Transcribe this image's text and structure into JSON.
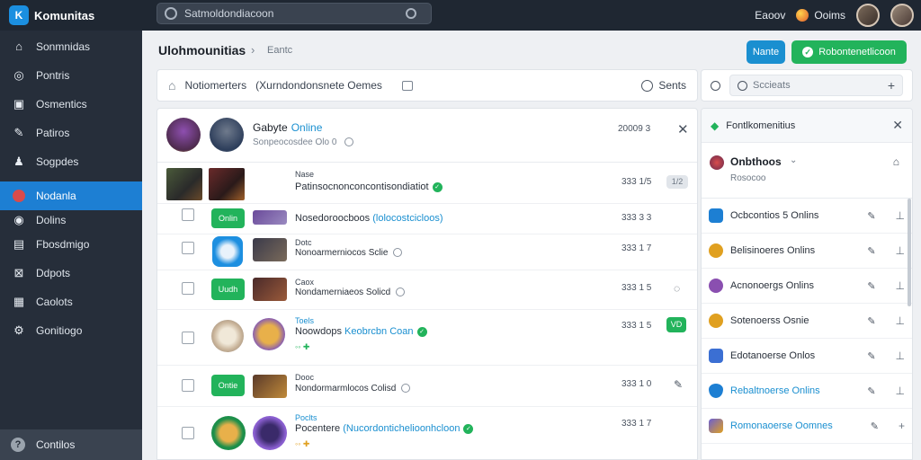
{
  "app": {
    "name": "Komunitas",
    "logo_letter": "K"
  },
  "topbar": {
    "search_placeholder": "Satmoldondiacoon",
    "link1": "Eaoov",
    "link2": "Ooims"
  },
  "sidebar": {
    "items": [
      {
        "label": "Sonmnidas",
        "icon": "home-icon"
      },
      {
        "label": "Pontris",
        "icon": "circle-icon"
      },
      {
        "label": "Osmentics",
        "icon": "document-icon"
      },
      {
        "label": "Patiros",
        "icon": "edit-icon"
      },
      {
        "label": "Sogpdes",
        "icon": "user-icon"
      },
      {
        "label": "Nodanla",
        "icon": "badge-icon",
        "active": true
      },
      {
        "label": "Dolins",
        "icon": "globe-icon"
      },
      {
        "label": "Fbosdmigo",
        "icon": "bag-icon"
      },
      {
        "label": "Ddpots",
        "icon": "share-icon"
      },
      {
        "label": "Caolots",
        "icon": "calendar-icon"
      },
      {
        "label": "Gonitiogo",
        "icon": "gear-icon"
      }
    ],
    "footer_label": "Contilos"
  },
  "header": {
    "title": "Ulohmounitias",
    "breadcrumb": "Eantc",
    "btn_primary": "Nante",
    "btn_success": "Robontenetlicoon"
  },
  "filter": {
    "label": "Notiomerters",
    "query": "(Xurndondonsnete Oemes",
    "sort_label": "Sents",
    "right_placeholder": "Sccieats"
  },
  "list": {
    "head": {
      "name": "Gabyte",
      "status": "Online",
      "subtitle": "Sonpeocosdee Olo",
      "count": "0",
      "id": "20009 3"
    },
    "rows": [
      {
        "title": "Nase",
        "text": "Patinsocnonconcontisondiatiot",
        "id": "333 1/5",
        "action": "1/2"
      },
      {
        "pill": "Onlin",
        "text": "Nosedoroocboos",
        "text_hl": "(lolocostcicloos)",
        "id": "333 3 3"
      },
      {
        "title": "Dotc",
        "text": "Nonoarmerniocos Sclie",
        "id": "333 1 7"
      },
      {
        "pill": "Uudh",
        "title": "Caox",
        "text": "Nondamerniaeos Solicd",
        "id": "333 1 5"
      },
      {
        "title": "Toels",
        "text": "Noowdops",
        "text_hl": "Keobrcbn Coan",
        "id": "333 1 5",
        "action": "VD"
      },
      {
        "pill": "Ontie",
        "title": "Dooc",
        "text": "Nondormarmlocos Colisd",
        "id": "333 1 0"
      },
      {
        "title": "Poclts",
        "text": "Pocentere",
        "text_hl": "(Nucordontichelioonhcloon",
        "id": "333 1 7"
      }
    ]
  },
  "panel": {
    "title": "Fontlkomenitius",
    "user_name": "Onbthoos",
    "user_sub": "Rosocoo",
    "items": [
      {
        "label": "Ocbcontios 5 Onlins",
        "color": "#1d7fd3",
        "blue": false
      },
      {
        "label": "Belisinoeres Onlins",
        "color": "#e0a020",
        "blue": false
      },
      {
        "label": "Acnonoergs Onlins",
        "color": "#8a4fb0",
        "blue": false
      },
      {
        "label": "Sotenoerss Osnie",
        "color": "#e0a020",
        "blue": false
      },
      {
        "label": "Edotanoerse Onlos",
        "color": "#3b6fd3",
        "blue": false
      },
      {
        "label": "Rebaltnoerse Onlins",
        "color": "#1d7fd3",
        "blue": true
      },
      {
        "label": "Romonaoerse Oomnes",
        "color": "#6a5fd3",
        "blue": true
      }
    ]
  }
}
